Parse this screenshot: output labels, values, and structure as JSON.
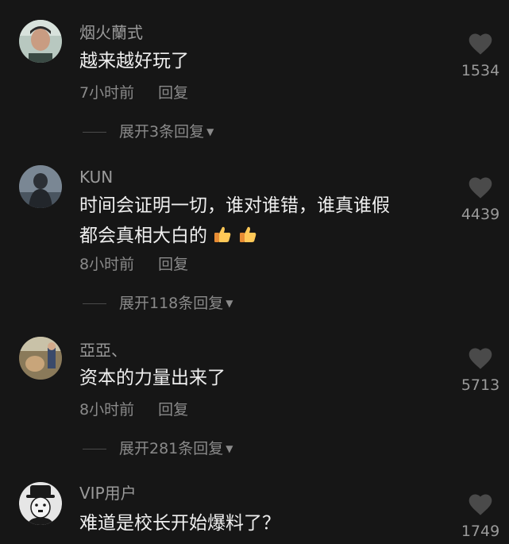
{
  "comments": [
    {
      "username": "烟火蘭式",
      "text": "越来越好玩了",
      "time": "7小时前",
      "reply_label": "回复",
      "expand_label": "展开3条回复",
      "likes": "1534",
      "avatar_icon": "avatar-man-portrait"
    },
    {
      "username": "KUN",
      "text_line1": "时间会证明一切，谁对谁错，谁真谁假",
      "text_line2": "都会真相大白的",
      "emojis": [
        "thumbs-up-emoji",
        "thumbs-up-emoji"
      ],
      "time": "8小时前",
      "reply_label": "回复",
      "expand_label": "展开118条回复",
      "likes": "4439",
      "avatar_icon": "avatar-person-hooded"
    },
    {
      "username": "亞亞、",
      "text": "资本的力量出来了",
      "time": "8小时前",
      "reply_label": "回复",
      "expand_label": "展开281条回复",
      "likes": "5713",
      "avatar_icon": "avatar-outdoor-photo"
    },
    {
      "username": "VIP用户",
      "text": "难道是校长开始爆料了？",
      "likes": "1749",
      "avatar_icon": "avatar-chaplin-cartoon"
    }
  ],
  "colors": {
    "background": "#161616",
    "text_primary": "#efefef",
    "text_secondary": "#8a8a8a",
    "heart": "#4a4a4a"
  }
}
